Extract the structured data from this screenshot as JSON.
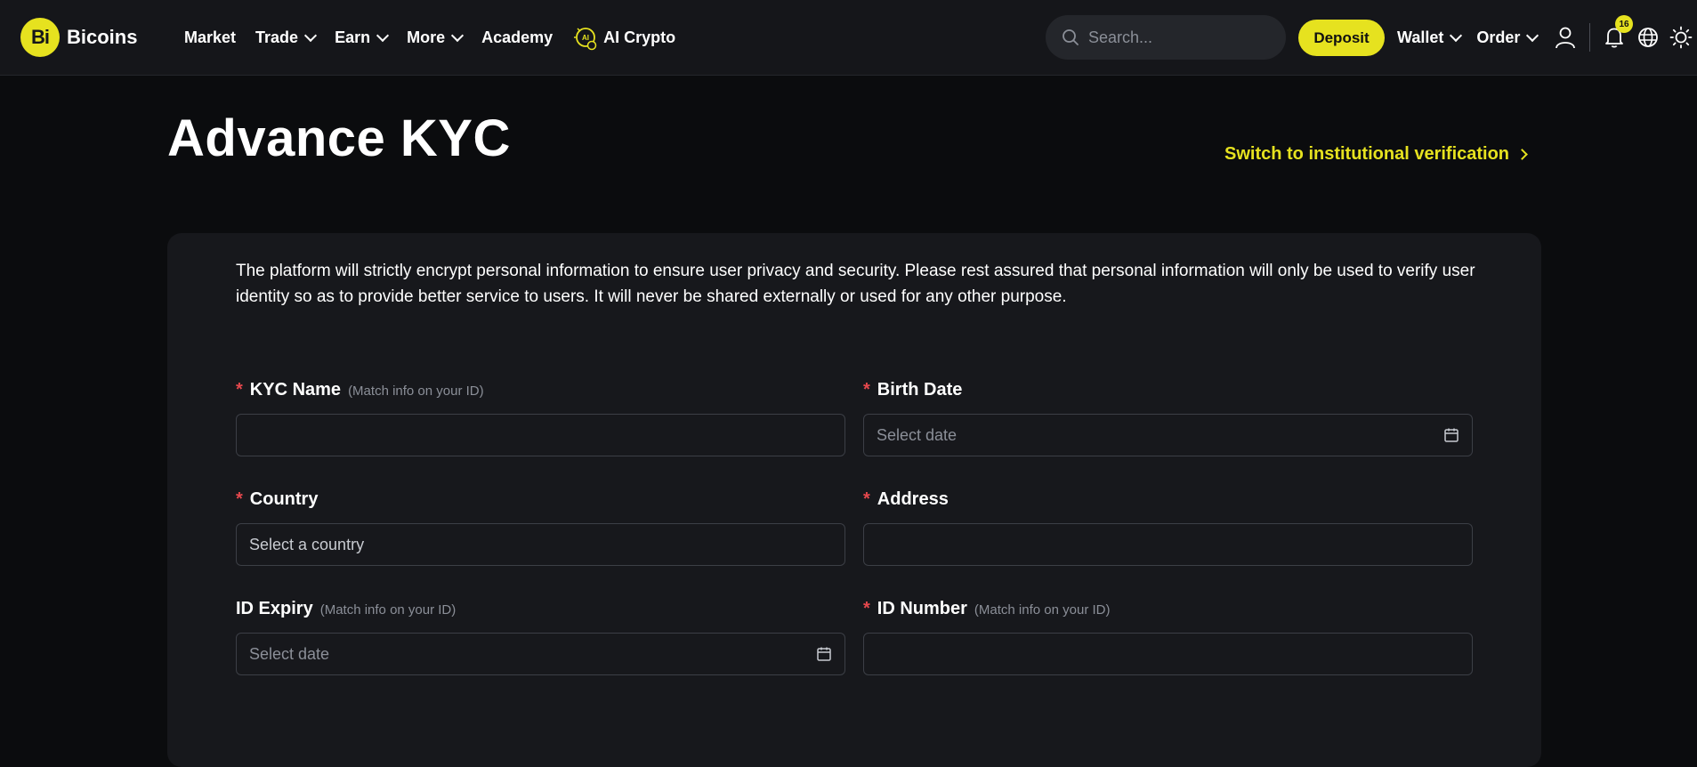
{
  "header": {
    "brand": "Bicoins",
    "logo_glyph": "Bi",
    "nav": [
      {
        "label": "Market",
        "has_dropdown": false
      },
      {
        "label": "Trade",
        "has_dropdown": true
      },
      {
        "label": "Earn",
        "has_dropdown": true
      },
      {
        "label": "More",
        "has_dropdown": true
      },
      {
        "label": "Academy",
        "has_dropdown": false
      },
      {
        "label": "AI Crypto",
        "has_dropdown": false,
        "icon": "ai-chip-icon"
      }
    ],
    "search_placeholder": "Search...",
    "deposit_label": "Deposit",
    "wallet_label": "Wallet",
    "order_label": "Order",
    "notification_count": "16",
    "icons": [
      "search-icon",
      "user-icon",
      "bell-icon",
      "globe-icon",
      "sun-icon"
    ]
  },
  "page": {
    "title": "Advance KYC",
    "switch_link": "Switch to institutional verification",
    "notice": "The platform will strictly encrypt personal information to ensure user privacy and security. Please rest assured that personal information will only be used to verify user identity so as to provide better service to users. It will never be shared externally or used for any other purpose."
  },
  "form": {
    "kyc_name": {
      "label": "KYC Name",
      "hint": "(Match info on your ID)",
      "required": true,
      "value": ""
    },
    "birth_date": {
      "label": "Birth Date",
      "hint": "",
      "required": true,
      "placeholder": "Select date"
    },
    "country": {
      "label": "Country",
      "hint": "",
      "required": true,
      "value": "Select a country"
    },
    "address": {
      "label": "Address",
      "hint": "",
      "required": true,
      "value": ""
    },
    "id_expiry": {
      "label": "ID Expiry",
      "hint": "(Match info on your ID)",
      "required": false,
      "placeholder": "Select date"
    },
    "id_number": {
      "label": "ID Number",
      "hint": "(Match info on your ID)",
      "required": true,
      "value": ""
    }
  },
  "colors": {
    "accent": "#e6e21f",
    "background": "#0b0c0e",
    "header_bg": "#15161a",
    "card_bg": "#17181c",
    "required": "#e5484d"
  }
}
